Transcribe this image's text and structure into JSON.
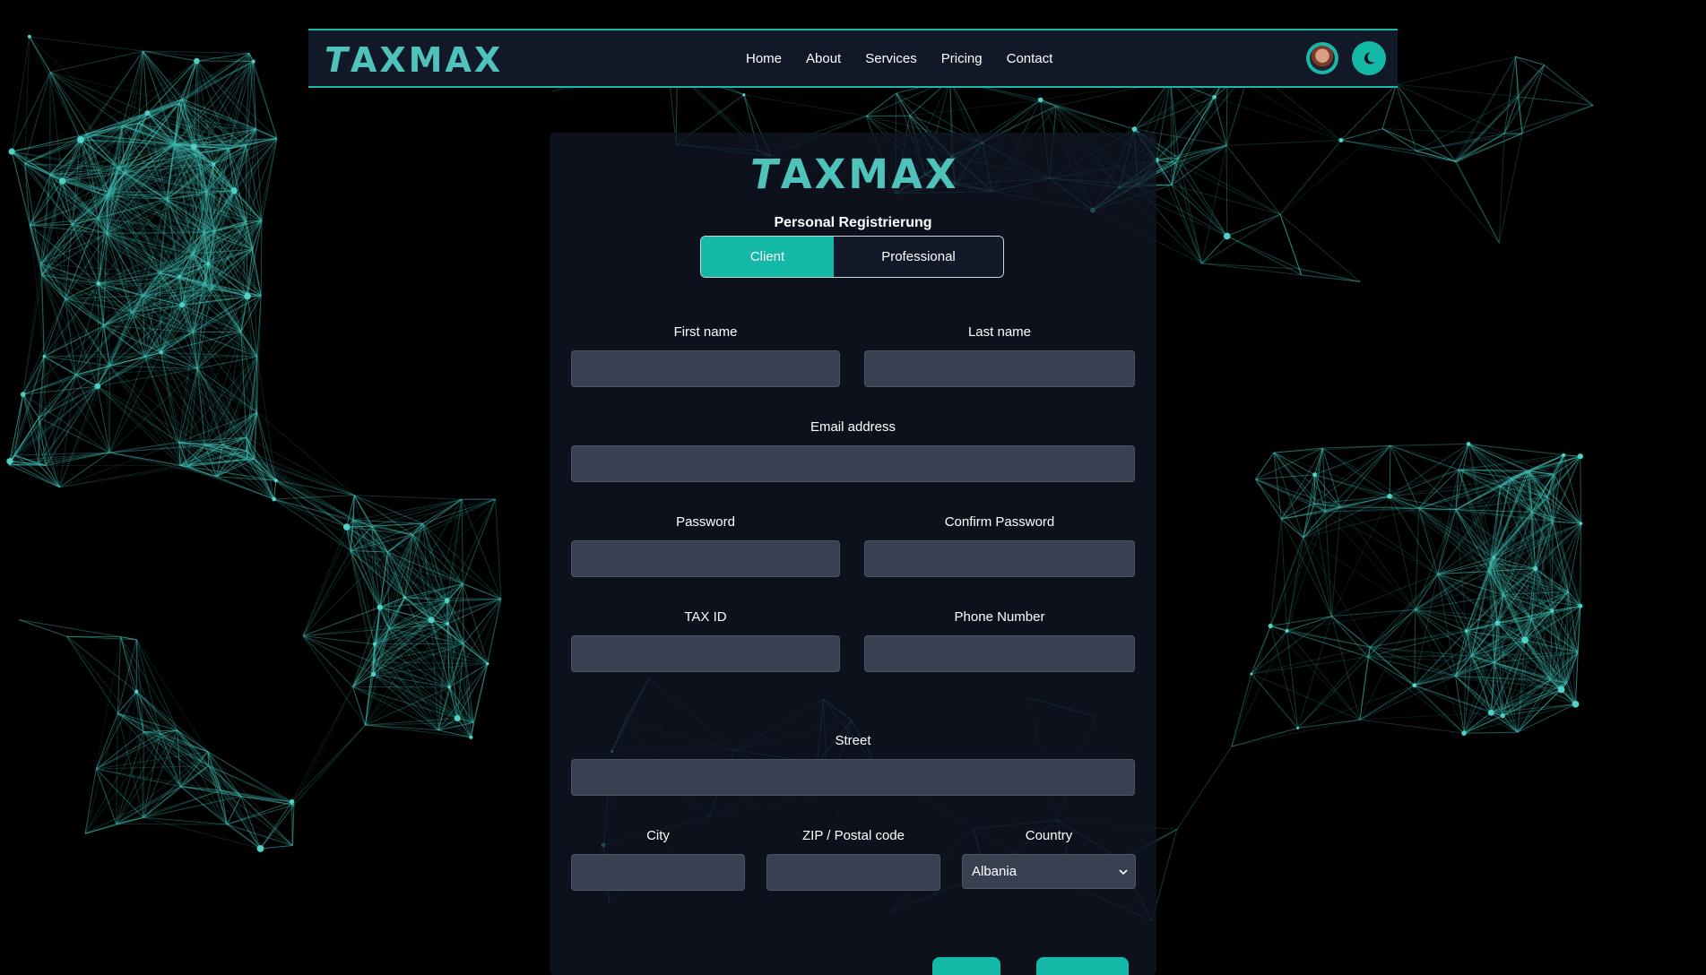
{
  "brand": {
    "name": "AXMAX",
    "letter": "T"
  },
  "nav": {
    "links": [
      "Home",
      "About",
      "Services",
      "Pricing",
      "Contact"
    ]
  },
  "icons": {
    "avatar": "user-avatar",
    "theme": "moon-icon",
    "select": "chevron-down-icon"
  },
  "colors": {
    "accent": "#14b8a6",
    "logo": "#4fc3bb",
    "panel": "#111827",
    "input": "#374151",
    "background": "#000000"
  },
  "form": {
    "title": "Personal Registrierung",
    "toggle": {
      "client": "Client",
      "professional": "Professional",
      "selected": "Client"
    },
    "fields": {
      "first_name": {
        "label": "First name",
        "value": ""
      },
      "last_name": {
        "label": "Last name",
        "value": ""
      },
      "email": {
        "label": "Email address",
        "value": ""
      },
      "password": {
        "label": "Password",
        "value": ""
      },
      "confirm_password": {
        "label": "Confirm Password",
        "value": ""
      },
      "tax_id": {
        "label": "TAX ID",
        "value": ""
      },
      "phone": {
        "label": "Phone Number",
        "value": ""
      },
      "street": {
        "label": "Street",
        "value": ""
      },
      "city": {
        "label": "City",
        "value": ""
      },
      "zip": {
        "label": "ZIP / Postal code",
        "value": ""
      },
      "country": {
        "label": "Country",
        "value": "Albania"
      }
    }
  }
}
